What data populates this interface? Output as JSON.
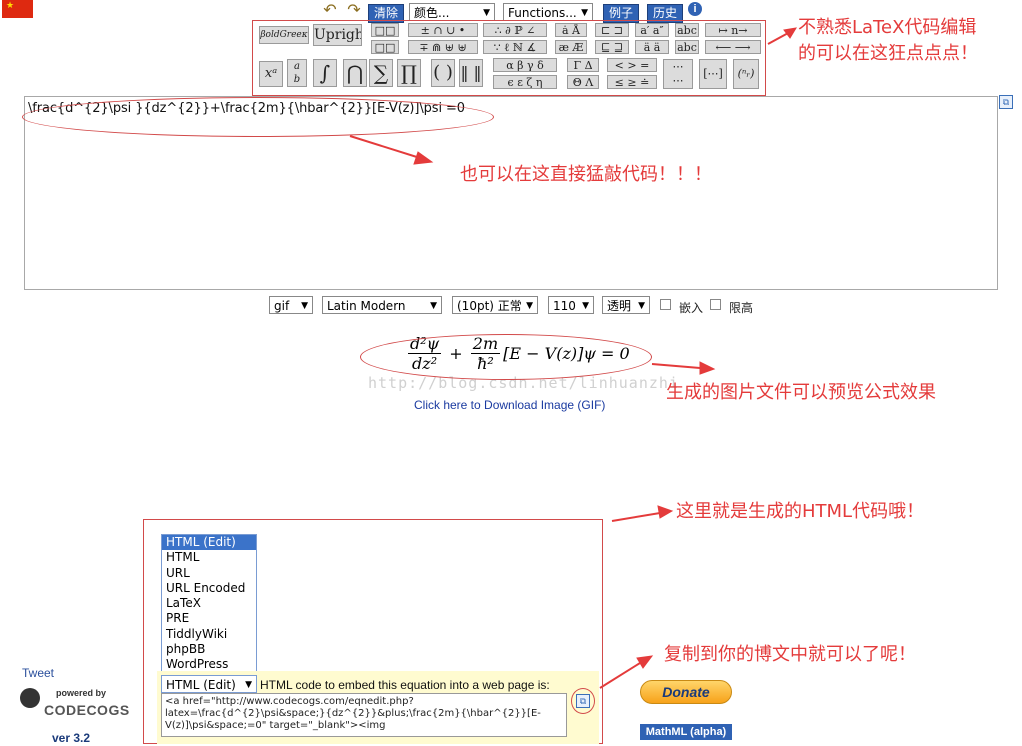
{
  "toolbar": {
    "clear": "清除",
    "color_select": "颜色...",
    "functions_select": "Functions...",
    "examples": "例子",
    "history": "历史",
    "info": "i"
  },
  "palette": {
    "bold_green": "βoldGreeκ",
    "upright": "Upright"
  },
  "editor": {
    "latex": "\\frac{d^{2}\\psi }{dz^{2}}+\\frac{2m}{\\hbar^{2}}[E-V(z)]\\psi =0"
  },
  "options": {
    "format": "gif",
    "font": "Latin Modern",
    "size": "(10pt) 正常",
    "dpi": "110",
    "background": "透明",
    "inline_label": "嵌入",
    "compressed_label": "限高"
  },
  "preview": {
    "watermark": "http://blog.csdn.net/linhuanzhi",
    "download_link": "Click here to Download Image (GIF)"
  },
  "annotations": {
    "palette_line1": "不熟悉LaTeX代码编辑",
    "palette_line2": "的可以在这狂点点点！",
    "editor": "也可以在这直接猛敲代码！！！",
    "preview": "生成的图片文件可以预览公式效果",
    "html_code": "这里就是生成的HTML代码哦！",
    "copy": "复制到你的博文中就可以了呢！"
  },
  "output": {
    "list_items": [
      "HTML (Edit)",
      "HTML",
      "URL",
      "URL Encoded",
      "LaTeX",
      "PRE",
      "TiddlyWiki",
      "phpBB",
      "WordPress"
    ],
    "selected": "HTML (Edit)",
    "embed_label": "HTML code to embed this equation into a web page is:",
    "code": "<a href=\"http://www.codecogs.com/eqnedit.php?latex=\\frac{d^{2}\\psi&space;}{dz^{2}}&plus;\\frac{2m}{\\hbar^{2}}[E-V(z)]\\psi&space;=0\" target=\"_blank\"><img"
  },
  "sidebar": {
    "tweet": "Tweet",
    "powered_by": "powered by",
    "brand": "CODECOGS",
    "version": "ver 3.2",
    "donate": "Donate",
    "mathml": "MathML (alpha)"
  }
}
